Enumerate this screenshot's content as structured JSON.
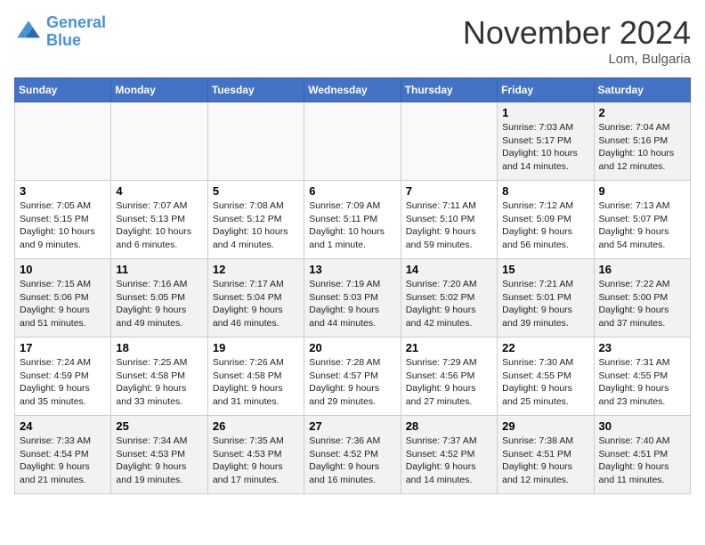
{
  "header": {
    "logo_line1": "General",
    "logo_line2": "Blue",
    "month": "November 2024",
    "location": "Lom, Bulgaria"
  },
  "weekdays": [
    "Sunday",
    "Monday",
    "Tuesday",
    "Wednesday",
    "Thursday",
    "Friday",
    "Saturday"
  ],
  "weeks": [
    [
      {
        "day": "",
        "info": ""
      },
      {
        "day": "",
        "info": ""
      },
      {
        "day": "",
        "info": ""
      },
      {
        "day": "",
        "info": ""
      },
      {
        "day": "",
        "info": ""
      },
      {
        "day": "1",
        "info": "Sunrise: 7:03 AM\nSunset: 5:17 PM\nDaylight: 10 hours\nand 14 minutes."
      },
      {
        "day": "2",
        "info": "Sunrise: 7:04 AM\nSunset: 5:16 PM\nDaylight: 10 hours\nand 12 minutes."
      }
    ],
    [
      {
        "day": "3",
        "info": "Sunrise: 7:05 AM\nSunset: 5:15 PM\nDaylight: 10 hours\nand 9 minutes."
      },
      {
        "day": "4",
        "info": "Sunrise: 7:07 AM\nSunset: 5:13 PM\nDaylight: 10 hours\nand 6 minutes."
      },
      {
        "day": "5",
        "info": "Sunrise: 7:08 AM\nSunset: 5:12 PM\nDaylight: 10 hours\nand 4 minutes."
      },
      {
        "day": "6",
        "info": "Sunrise: 7:09 AM\nSunset: 5:11 PM\nDaylight: 10 hours\nand 1 minute."
      },
      {
        "day": "7",
        "info": "Sunrise: 7:11 AM\nSunset: 5:10 PM\nDaylight: 9 hours\nand 59 minutes."
      },
      {
        "day": "8",
        "info": "Sunrise: 7:12 AM\nSunset: 5:09 PM\nDaylight: 9 hours\nand 56 minutes."
      },
      {
        "day": "9",
        "info": "Sunrise: 7:13 AM\nSunset: 5:07 PM\nDaylight: 9 hours\nand 54 minutes."
      }
    ],
    [
      {
        "day": "10",
        "info": "Sunrise: 7:15 AM\nSunset: 5:06 PM\nDaylight: 9 hours\nand 51 minutes."
      },
      {
        "day": "11",
        "info": "Sunrise: 7:16 AM\nSunset: 5:05 PM\nDaylight: 9 hours\nand 49 minutes."
      },
      {
        "day": "12",
        "info": "Sunrise: 7:17 AM\nSunset: 5:04 PM\nDaylight: 9 hours\nand 46 minutes."
      },
      {
        "day": "13",
        "info": "Sunrise: 7:19 AM\nSunset: 5:03 PM\nDaylight: 9 hours\nand 44 minutes."
      },
      {
        "day": "14",
        "info": "Sunrise: 7:20 AM\nSunset: 5:02 PM\nDaylight: 9 hours\nand 42 minutes."
      },
      {
        "day": "15",
        "info": "Sunrise: 7:21 AM\nSunset: 5:01 PM\nDaylight: 9 hours\nand 39 minutes."
      },
      {
        "day": "16",
        "info": "Sunrise: 7:22 AM\nSunset: 5:00 PM\nDaylight: 9 hours\nand 37 minutes."
      }
    ],
    [
      {
        "day": "17",
        "info": "Sunrise: 7:24 AM\nSunset: 4:59 PM\nDaylight: 9 hours\nand 35 minutes."
      },
      {
        "day": "18",
        "info": "Sunrise: 7:25 AM\nSunset: 4:58 PM\nDaylight: 9 hours\nand 33 minutes."
      },
      {
        "day": "19",
        "info": "Sunrise: 7:26 AM\nSunset: 4:58 PM\nDaylight: 9 hours\nand 31 minutes."
      },
      {
        "day": "20",
        "info": "Sunrise: 7:28 AM\nSunset: 4:57 PM\nDaylight: 9 hours\nand 29 minutes."
      },
      {
        "day": "21",
        "info": "Sunrise: 7:29 AM\nSunset: 4:56 PM\nDaylight: 9 hours\nand 27 minutes."
      },
      {
        "day": "22",
        "info": "Sunrise: 7:30 AM\nSunset: 4:55 PM\nDaylight: 9 hours\nand 25 minutes."
      },
      {
        "day": "23",
        "info": "Sunrise: 7:31 AM\nSunset: 4:55 PM\nDaylight: 9 hours\nand 23 minutes."
      }
    ],
    [
      {
        "day": "24",
        "info": "Sunrise: 7:33 AM\nSunset: 4:54 PM\nDaylight: 9 hours\nand 21 minutes."
      },
      {
        "day": "25",
        "info": "Sunrise: 7:34 AM\nSunset: 4:53 PM\nDaylight: 9 hours\nand 19 minutes."
      },
      {
        "day": "26",
        "info": "Sunrise: 7:35 AM\nSunset: 4:53 PM\nDaylight: 9 hours\nand 17 minutes."
      },
      {
        "day": "27",
        "info": "Sunrise: 7:36 AM\nSunset: 4:52 PM\nDaylight: 9 hours\nand 16 minutes."
      },
      {
        "day": "28",
        "info": "Sunrise: 7:37 AM\nSunset: 4:52 PM\nDaylight: 9 hours\nand 14 minutes."
      },
      {
        "day": "29",
        "info": "Sunrise: 7:38 AM\nSunset: 4:51 PM\nDaylight: 9 hours\nand 12 minutes."
      },
      {
        "day": "30",
        "info": "Sunrise: 7:40 AM\nSunset: 4:51 PM\nDaylight: 9 hours\nand 11 minutes."
      }
    ]
  ]
}
